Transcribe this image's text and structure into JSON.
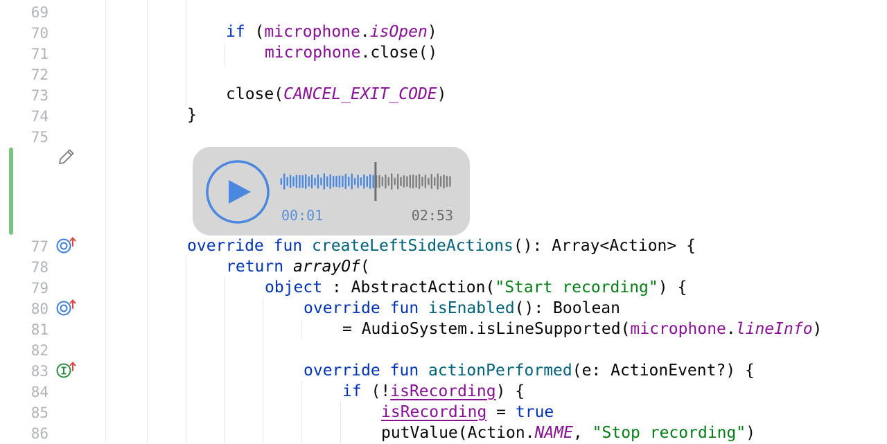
{
  "colors": {
    "keyword": "#0033b3",
    "function": "#00627a",
    "property": "#871094",
    "string": "#067d17",
    "text": "#080808",
    "line_number": "#b0b3b8",
    "change_marker": "#7cc47f",
    "player_bg": "#d6d6d6",
    "player_accent": "#4a88e0"
  },
  "line_numbers": [
    "69",
    "70",
    "71",
    "72",
    "73",
    "74",
    "75",
    "77",
    "78",
    "79",
    "80",
    "81",
    "82",
    "83",
    "84",
    "85",
    "86"
  ],
  "gutter_icons": [
    {
      "line": "77",
      "icon": "overriding-method-icon"
    },
    {
      "line": "80",
      "icon": "overriding-method-icon"
    },
    {
      "line": "83",
      "icon": "implementing-method-icon"
    }
  ],
  "code": {
    "l70": {
      "kw_if": "if",
      "open": " (",
      "obj": "microphone",
      "dot": ".",
      "prop": "isOpen",
      "close": ")"
    },
    "l71": {
      "obj": "microphone",
      "call": ".close()"
    },
    "l73": {
      "call": "close(",
      "const": "CANCEL_EXIT_CODE",
      "close": ")"
    },
    "l74": {
      "text": "}"
    },
    "l77": {
      "kw_override": "override",
      "kw_fun": "fun",
      "name": "createLeftSideActions",
      "rest": "(): Array<Action> {"
    },
    "l78": {
      "kw_return": "return",
      "fn": "arrayOf",
      "rest": "("
    },
    "l79": {
      "kw_object": "object",
      "rest1": " : AbstractAction(",
      "str": "\"Start recording\"",
      "rest2": ") {"
    },
    "l80": {
      "kw_override": "override",
      "kw_fun": "fun",
      "name": "isEnabled",
      "rest": "(): Boolean"
    },
    "l81": {
      "pre": "= AudioSystem.isLineSupported(",
      "obj": "microphone",
      "dot": ".",
      "prop": "lineInfo",
      "close": ")"
    },
    "l83": {
      "kw_override": "override",
      "kw_fun": "fun",
      "name": "actionPerformed",
      "rest": "(e: ActionEvent?) {"
    },
    "l84": {
      "kw_if": "if",
      "open": " (!",
      "prop": "isRecording",
      "close": ") {"
    },
    "l85": {
      "prop": "isRecording",
      "op": " = ",
      "kw_true": "true"
    },
    "l86": {
      "call": "putValue(Action.",
      "const": "NAME",
      "sep": ", ",
      "str": "\"Stop recording\"",
      "close": ")"
    }
  },
  "audio_player": {
    "current_time": "00:01",
    "total_time": "02:53",
    "progress": 0.55
  }
}
